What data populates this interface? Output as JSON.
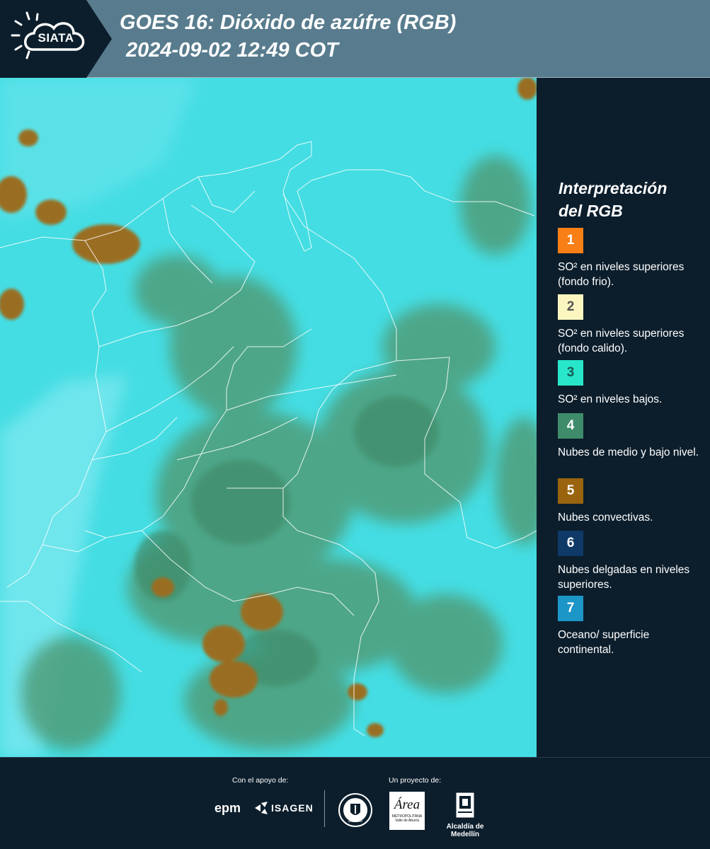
{
  "header": {
    "logo_text": "SIATA",
    "title_line1": "GOES 16: Dióxido de azúfre (RGB)",
    "title_line2": "2024-09-02 12:49 COT"
  },
  "legend": {
    "title_line1": "Interpretación",
    "title_line2": "del RGB",
    "items": [
      {
        "number": "1",
        "color": "#f77f16",
        "text_color": "#ffffff",
        "label": "SO² en niveles superiores (fondo frio)."
      },
      {
        "number": "2",
        "color": "#fbf6c0",
        "text_color": "#555555",
        "label": "SO² en niveles superiores (fondo calido)."
      },
      {
        "number": "3",
        "color": "#27e6c9",
        "text_color": "#1b5a55",
        "label": "SO² en niveles bajos."
      },
      {
        "number": "4",
        "color": "#3f8c6b",
        "text_color": "#ffffff",
        "label": "Nubes de medio y bajo nivel."
      },
      {
        "number": "5",
        "color": "#9a640e",
        "text_color": "#ffffff",
        "label": "Nubes convectivas."
      },
      {
        "number": "6",
        "color": "#0f3a67",
        "text_color": "#ffffff",
        "label": "Nubes delgadas en niveles superiores."
      },
      {
        "number": "7",
        "color": "#1c95c7",
        "text_color": "#ffffff",
        "label": "Oceano/ superficie continental."
      }
    ]
  },
  "footer": {
    "support_label": "Con el apoyo de:",
    "project_label": "Un proyecto de:",
    "sponsor1": "epm",
    "sponsor2": "ISAGEN",
    "partner_area": "Área",
    "partner_area_sub1": "METROPOLITANA",
    "partner_area_sub2": "Valle de Aburrá",
    "partner_alcaldia": "Alcaldía de Medellín",
    "seal_text": "MEDELLÍN"
  },
  "colors": {
    "background": "#0c1e2c",
    "header": "#587c8e",
    "map_cyan": "#44dde3",
    "map_green": "#3f8c6b",
    "map_brown": "#9a640e"
  }
}
